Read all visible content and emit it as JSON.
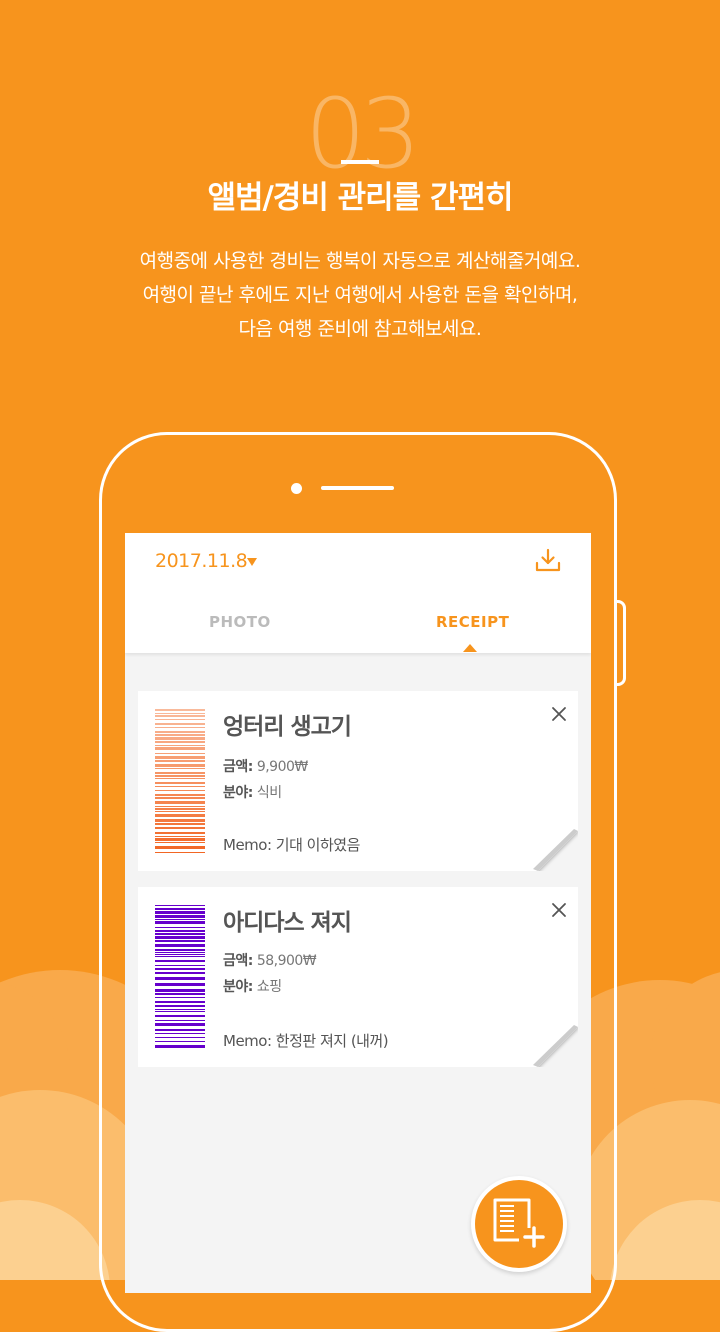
{
  "header": {
    "step_number": "03",
    "title": "앨범/경비 관리를 간편히",
    "description_lines": [
      "여행중에 사용한 경비는 행북이 자동으로 계산해줄거예요.",
      "여행이 끝난 후에도 지난 여행에서 사용한 돈을 확인하며,",
      "다음 여행 준비에 참고해보세요."
    ]
  },
  "app": {
    "date": "2017.11.8",
    "tabs": [
      {
        "label": "PHOTO",
        "active": false
      },
      {
        "label": "RECEIPT",
        "active": true
      }
    ]
  },
  "receipts": [
    {
      "title": "엉터리 생고기",
      "amount_label": "금액:",
      "amount": "9,900₩",
      "category_label": "분야:",
      "category": "식비",
      "memo_label": "Memo:",
      "memo": "기대 이하였음",
      "color": "#f26522"
    },
    {
      "title": "아디다스 져지",
      "amount_label": "금액:",
      "amount": "58,900₩",
      "category_label": "분야:",
      "category": "쇼핑",
      "memo_label": "Memo:",
      "memo": "한정판 져지 (내꺼)",
      "color": "#6600cc"
    }
  ],
  "colors": {
    "brand_orange": "#f7941d",
    "white": "#ffffff"
  },
  "icons": {
    "download": "download-icon",
    "close": "close-icon",
    "add_receipt": "add-receipt-icon"
  }
}
